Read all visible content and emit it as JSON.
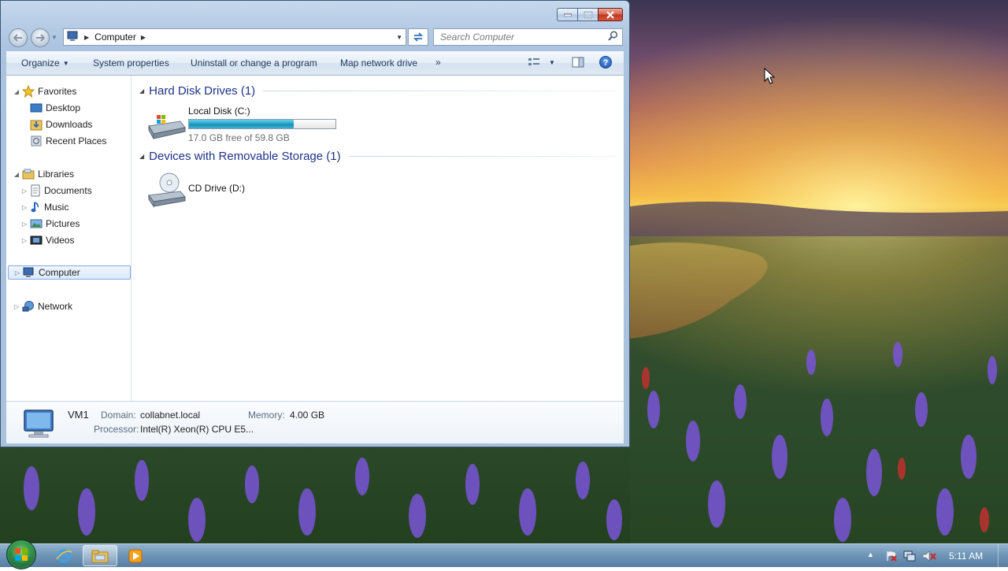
{
  "window": {
    "minimize_icon": "minimize-icon",
    "maximize_icon": "maximize-icon",
    "close_icon": "close-icon"
  },
  "address": {
    "crumb": "Computer",
    "search_placeholder": "Search Computer"
  },
  "commands": {
    "organize": "Organize",
    "system_properties": "System properties",
    "uninstall": "Uninstall or change a program",
    "map_drive": "Map network drive",
    "more": "»"
  },
  "nav": {
    "favorites": "Favorites",
    "desktop": "Desktop",
    "downloads": "Downloads",
    "recent_places": "Recent Places",
    "libraries": "Libraries",
    "documents": "Documents",
    "music": "Music",
    "pictures": "Pictures",
    "videos": "Videos",
    "computer": "Computer",
    "network": "Network"
  },
  "groups": {
    "hdd_header": "Hard Disk Drives (1)",
    "removable_header": "Devices with Removable Storage (1)"
  },
  "drives": {
    "local": {
      "name": "Local Disk (C:)",
      "free_text": "17.0 GB free of 59.8 GB",
      "used_fraction": 0.716
    },
    "cd": {
      "name": "CD Drive (D:)"
    }
  },
  "details": {
    "computer_name": "VM1",
    "domain_label": "Domain:",
    "domain_value": "collabnet.local",
    "memory_label": "Memory:",
    "memory_value": "4.00 GB",
    "processor_label": "Processor:",
    "processor_value": "Intel(R) Xeon(R) CPU E5..."
  },
  "taskbar": {
    "clock": "5:11 AM",
    "tray_arrow": "▲"
  },
  "colors": {
    "accent_header": "#1e3287",
    "progress_fill": "#28a6c9",
    "close_button": "#c2351e"
  }
}
